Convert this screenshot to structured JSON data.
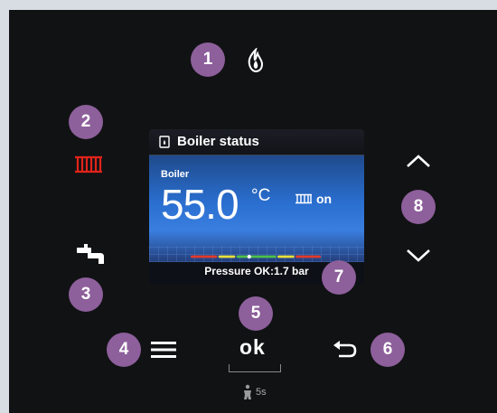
{
  "badges": [
    "1",
    "2",
    "3",
    "4",
    "5",
    "6",
    "7",
    "8"
  ],
  "screen": {
    "title": "Boiler status",
    "section_label": "Boiler",
    "temperature": "55.0",
    "unit": "°C",
    "heating_state": "on",
    "pressure_text": "Pressure OK:1.7 bar",
    "pressure_level": 0.45
  },
  "buttons": {
    "ok_label": "ok",
    "hold_hint": "5s"
  },
  "icons": {
    "flame": "flame-icon",
    "radiator": "radiator-icon",
    "tap": "tap-icon",
    "menu": "menu-icon",
    "back": "back-arrow-icon",
    "up": "chevron-up-icon",
    "down": "chevron-down-icon",
    "service": "service-person-icon"
  },
  "colors": {
    "badge": "#8d5f9b",
    "radiator_active": "#e2231a",
    "panel": "#111214",
    "screen_blue": "#2a6fd0"
  }
}
